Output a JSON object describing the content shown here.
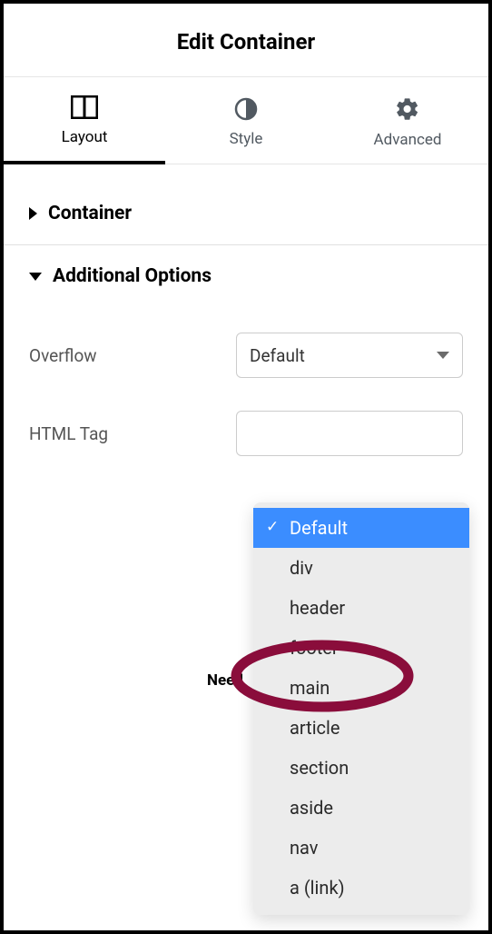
{
  "header": {
    "title": "Edit Container"
  },
  "tabs": {
    "layout": {
      "label": "Layout",
      "active": true
    },
    "style": {
      "label": "Style",
      "active": false
    },
    "advanced": {
      "label": "Advanced",
      "active": false
    }
  },
  "sections": {
    "container": {
      "title": "Container",
      "expanded": false
    },
    "additional": {
      "title": "Additional Options",
      "expanded": true
    }
  },
  "options": {
    "overflow": {
      "label": "Overflow",
      "value": "Default"
    },
    "htmlTag": {
      "label": "HTML Tag",
      "selected": "Default",
      "items": [
        "Default",
        "div",
        "header",
        "footer",
        "main",
        "article",
        "section",
        "aside",
        "nav",
        "a (link)"
      ]
    }
  },
  "annotation": {
    "highlighted_option": "main",
    "partial_text": "Need"
  }
}
